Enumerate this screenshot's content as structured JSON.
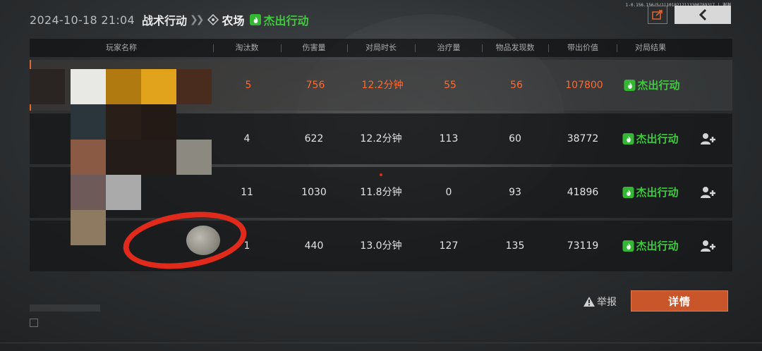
{
  "header": {
    "datetime": "2024-10-18 21:04",
    "mode": "战术行动",
    "map": "农场",
    "status": "杰出行动",
    "tiny_info": "1-0.156.156/5/1|1018212113300789317 | 谢谢"
  },
  "table": {
    "columns": [
      "玩家名称",
      "淘汰数",
      "伤害量",
      "对局时长",
      "治疗量",
      "物品发现数",
      "带出价值",
      "对局结果"
    ],
    "rows": [
      {
        "kills": "5",
        "damage": "756",
        "duration": "12.2分钟",
        "healing": "55",
        "items": "56",
        "value": "107800",
        "result": "杰出行动",
        "highlight": true
      },
      {
        "kills": "4",
        "damage": "622",
        "duration": "12.2分钟",
        "healing": "113",
        "items": "60",
        "value": "38772",
        "result": "杰出行动"
      },
      {
        "kills": "11",
        "damage": "1030",
        "duration": "11.8分钟",
        "healing": "0",
        "items": "93",
        "value": "41896",
        "result": "杰出行动"
      },
      {
        "kills": "1",
        "damage": "440",
        "duration": "13.0分钟",
        "healing": "127",
        "items": "135",
        "value": "73119",
        "result": "杰出行动"
      }
    ]
  },
  "actions": {
    "report": "举报",
    "details": "详情"
  },
  "icons": {
    "share": "share-icon",
    "back": "back-arrow-icon",
    "map": "map-diamond-icon",
    "result": "flame-icon",
    "add_friend": "add-friend-icon",
    "report": "warning-icon"
  },
  "colors": {
    "accent": "#e1662e",
    "success": "#3ec93e",
    "button": "#c9552b",
    "highlight_text": "#ff6a2e",
    "annotation": "#e02a1c"
  }
}
